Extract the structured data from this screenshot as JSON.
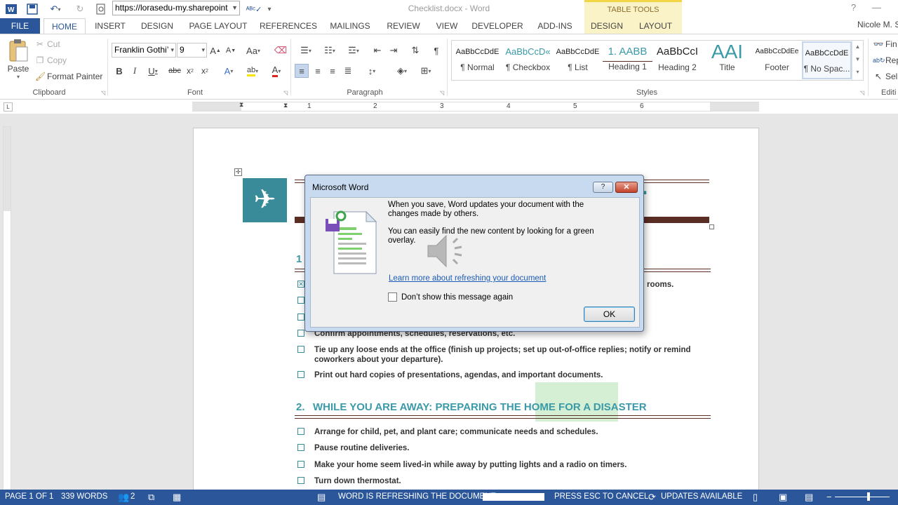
{
  "titlebar": {
    "url": "https://lorasedu-my.sharepoint",
    "doc_title": "Checklist.docx - Word",
    "table_tools": "TABLE TOOLS",
    "help": "?",
    "minimize": "—"
  },
  "tabs": {
    "file": "FILE",
    "items": [
      "HOME",
      "INSERT",
      "DESIGN",
      "PAGE LAYOUT",
      "REFERENCES",
      "MAILINGS",
      "REVIEW",
      "VIEW",
      "DEVELOPER",
      "ADD-INS",
      "DESIGN",
      "LAYOUT"
    ],
    "user": "Nicole M. S"
  },
  "ribbon": {
    "clipboard": {
      "paste": "Paste",
      "cut": "Cut",
      "copy": "Copy",
      "format_painter": "Format Painter",
      "label": "Clipboard"
    },
    "font": {
      "font_name": "Franklin Gothi’",
      "font_size": "9",
      "label": "Font"
    },
    "paragraph": {
      "label": "Paragraph"
    },
    "styles": {
      "label": "Styles",
      "items": [
        {
          "preview": "AaBbCcDdE",
          "name": "¶ Normal"
        },
        {
          "preview": "AaBbCcD«",
          "name": "¶ Checkbox"
        },
        {
          "preview": "AaBbCcDdE",
          "name": "¶ List"
        },
        {
          "preview": "1. AABB",
          "name": "Heading 1"
        },
        {
          "preview": "AaBbCcI",
          "name": "Heading 2"
        },
        {
          "preview": "AAI",
          "name": "Title"
        },
        {
          "preview": "AaBbCcDdEe",
          "name": "Footer"
        },
        {
          "preview": "AaBbCcDdE",
          "name": "¶ No Spac..."
        }
      ]
    },
    "editing": {
      "find": "Fin",
      "replace": "Rep",
      "select": "Sel",
      "label": "Editi"
    }
  },
  "ruler": {
    "numbers": [
      "1",
      "2",
      "3",
      "4",
      "5",
      "6"
    ]
  },
  "document": {
    "title_fragment": "T",
    "section1_number": "1",
    "section1_item1_tail": "rooms.",
    "section1_items": [
      "Confirm appointments, schedules, reservations, etc.",
      "Tie up any loose ends at the office (finish up projects; set up out-of-office replies; notify or remind coworkers about your departure).",
      "Print out hard copies of presentations, agendas, and important documents."
    ],
    "section2_number": "2.",
    "section2_title": "WHILE YOU ARE AWAY: PREPARING THE HOME FOR A DISASTER",
    "section2_items": [
      "Arrange for child, pet, and plant care; communicate needs and schedules.",
      "Pause routine deliveries.",
      "Make your home seem lived-in while away by putting lights and a radio on timers.",
      "Turn down thermostat."
    ]
  },
  "dialog": {
    "title": "Microsoft Word",
    "help": "?",
    "close": "✕",
    "message1": "When you save, Word updates your document with the changes made by others.",
    "message2": "You can easily find the new content by looking for a green overlay.",
    "link": "Learn more about refreshing your document",
    "checkbox_label": "Don’t show this message again",
    "ok": "OK"
  },
  "statusbar": {
    "page": "PAGE 1 OF 1",
    "words": "339 WORDS",
    "authors": "2",
    "refreshing": "WORD IS REFRESHING THE DOCUMENT:",
    "cancel": "PRESS ESC TO CANCEL.",
    "updates": "UPDATES AVAILABLE"
  },
  "colors": {
    "accent": "#2b579a",
    "teal": "#3a9aa7",
    "brown": "#5a2e25",
    "table_tools": "#fbf3c8"
  }
}
